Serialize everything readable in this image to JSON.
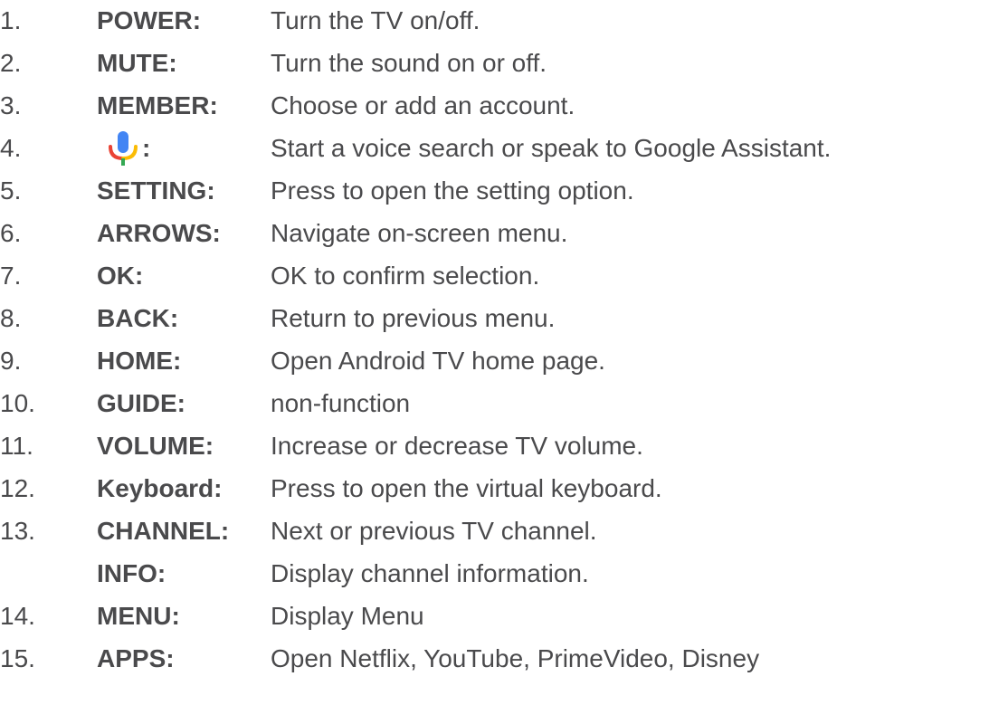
{
  "items": [
    {
      "num": "1.",
      "key": "POWER:",
      "desc": "Turn the TV on/off."
    },
    {
      "num": "2.",
      "key": "MUTE:",
      "desc": "Turn the sound on or off."
    },
    {
      "num": "3.",
      "key": "MEMBER:",
      "desc": "Choose or add an account."
    },
    {
      "num": "4.",
      "key": ":",
      "icon": "google-assistant-mic-icon",
      "desc": "Start a voice search or speak to Google Assistant."
    },
    {
      "num": "5.",
      "key": "SETTING:",
      "desc": "Press to open the setting option."
    },
    {
      "num": "6.",
      "key": "ARROWS:",
      "desc": "Navigate on-screen menu."
    },
    {
      "num": "7.",
      "key": "OK:",
      "desc": "OK to confirm selection."
    },
    {
      "num": "8.",
      "key": "BACK:",
      "desc": "Return to previous menu."
    },
    {
      "num": "9.",
      "key": "HOME:",
      "desc": "Open Android TV home page."
    },
    {
      "num": "10.",
      "key": "GUIDE:",
      "desc": "non-function"
    },
    {
      "num": "11.",
      "key": "VOLUME:",
      "desc": "Increase or decrease TV volume."
    },
    {
      "num": "12.",
      "key": "Keyboard:",
      "desc": "Press to open the virtual keyboard."
    },
    {
      "num": "13.",
      "key": "CHANNEL:",
      "desc": "Next or previous TV channel."
    },
    {
      "num": "",
      "key": "INFO:",
      "desc": "Display channel information."
    },
    {
      "num": "14.",
      "key": "MENU:",
      "desc": "Display Menu"
    },
    {
      "num": "15.",
      "key": "APPS:",
      "desc": "Open Netflix, YouTube, PrimeVideo, Disney"
    }
  ],
  "colors": {
    "text": "#4a4a4c",
    "mic_blue": "#4285F4",
    "mic_red": "#EA4335",
    "mic_yellow": "#FBBC05",
    "mic_green": "#34A853"
  }
}
